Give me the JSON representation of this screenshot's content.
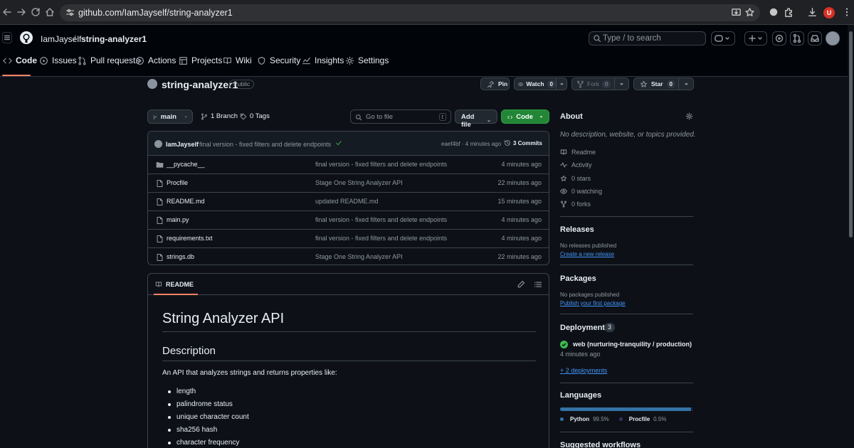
{
  "browser": {
    "url": "github.com/IamJayself/string-analyzer1",
    "profile_initial": "U"
  },
  "header": {
    "owner": "IamJayself",
    "separator": "/",
    "repo": "string-analyzer1",
    "search_placeholder": "Type / to search"
  },
  "tabs": [
    {
      "label": "Code",
      "icon": "code-icon"
    },
    {
      "label": "Issues",
      "icon": "issue-icon"
    },
    {
      "label": "Pull requests",
      "icon": "pull-request-icon"
    },
    {
      "label": "Actions",
      "icon": "play-icon"
    },
    {
      "label": "Projects",
      "icon": "table-icon"
    },
    {
      "label": "Wiki",
      "icon": "book-icon"
    },
    {
      "label": "Security",
      "icon": "shield-icon"
    },
    {
      "label": "Insights",
      "icon": "graph-icon"
    },
    {
      "label": "Settings",
      "icon": "gear-icon"
    }
  ],
  "repo": {
    "title": "string-analyzer1",
    "visibility": "Public",
    "pin_label": "Pin",
    "watch_label": "Watch",
    "watch_count": "0",
    "fork_label": "Fork",
    "fork_count": "0",
    "star_label": "Star",
    "star_count": "0"
  },
  "toolbar": {
    "branch": "main",
    "branch_count": "1 Branch",
    "tag_count": "0 Tags",
    "goto_placeholder": "Go to file",
    "goto_shortcut": "t",
    "add_file_label": "Add file",
    "code_label": "Code"
  },
  "commit": {
    "author": "IamJayself",
    "message": "final version - fixed filters and delete endpoints",
    "hash_time": "eaef4bf · 4 minutes ago",
    "commits_label": "3 Commits"
  },
  "files": [
    {
      "name": "__pycache__",
      "type": "folder",
      "message": "final version - fixed filters and delete endpoints",
      "time": "4 minutes ago"
    },
    {
      "name": "Procfile",
      "type": "file",
      "message": "Stage One String Analyzer API",
      "time": "22 minutes ago"
    },
    {
      "name": "README.md",
      "type": "file",
      "message": "updated README.md",
      "time": "15 minutes ago"
    },
    {
      "name": "main.py",
      "type": "file",
      "message": "final version - fixed filters and delete endpoints",
      "time": "4 minutes ago"
    },
    {
      "name": "requirements.txt",
      "type": "file",
      "message": "final version - fixed filters and delete endpoints",
      "time": "4 minutes ago"
    },
    {
      "name": "strings.db",
      "type": "file",
      "message": "Stage One String Analyzer API",
      "time": "22 minutes ago"
    }
  ],
  "readme": {
    "tab_label": "README",
    "h1": "String Analyzer API",
    "h2": "Description",
    "intro": "An API that analyzes strings and returns properties like:",
    "items": [
      "length",
      "palindrome status",
      "unique character count",
      "sha256 hash",
      "character frequency"
    ]
  },
  "about": {
    "title": "About",
    "description": "No description, website, or topics provided.",
    "readme": "Readme",
    "activity": "Activity",
    "stars": "0 stars",
    "watching": "0 watching",
    "forks": "0 forks"
  },
  "releases": {
    "title": "Releases",
    "none": "No releases published",
    "link": "Create a new release"
  },
  "packages": {
    "title": "Packages",
    "none": "No packages published",
    "link": "Publish your first package"
  },
  "deployments": {
    "title": "Deployments",
    "count": "3",
    "env": "web (nurturing-tranquility / production)",
    "time": "4 minutes ago",
    "more": "+ 2 deployments"
  },
  "languages": {
    "title": "Languages",
    "items": [
      {
        "name": "Python",
        "pct": "99.5%",
        "value": 99.5,
        "color": "#3572A5"
      },
      {
        "name": "Procfile",
        "pct": "0.5%",
        "value": 0.5,
        "color": "#3b2f63"
      }
    ]
  },
  "workflows": {
    "title": "Suggested workflows"
  }
}
